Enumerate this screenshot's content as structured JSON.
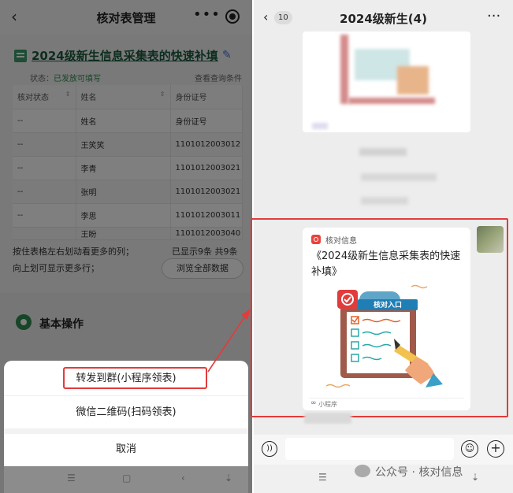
{
  "left_phone": {
    "header": {
      "back_icon": "chevron-left-icon",
      "title": "核对表管理",
      "more_glyph": "•••",
      "target_icon": "target-icon"
    },
    "form_title": "2024级新生信息采集表的快速补填",
    "status_label": "状态：",
    "status_value": "已发放可填写",
    "query_link": "查看查询条件",
    "table": {
      "headers": [
        "核对状态",
        "姓名",
        "身份证号"
      ],
      "rows": [
        [
          "--",
          "姓名",
          "身份证号"
        ],
        [
          "--",
          "王笑笑",
          "1101012003012"
        ],
        [
          "--",
          "李青",
          "1101012003021"
        ],
        [
          "--",
          "张明",
          "1101012003021"
        ],
        [
          "--",
          "李思",
          "1101012003011"
        ],
        [
          "",
          "王盼",
          "1101012003040"
        ]
      ]
    },
    "scroll_hint_1": "按住表格左右划动看更多的列；",
    "scroll_hint_2": "向上划可显示更多行；",
    "shown_count": "已显示9条 共9条",
    "browse_all_button": "浏览全部数据",
    "basic_ops_title": "基本操作",
    "action_sheet": {
      "option_forward_group": "转发到群(小程序领表)",
      "option_qr_code": "微信二维码(扫码领表)",
      "cancel": "取消"
    }
  },
  "right_phone": {
    "header": {
      "unread_count": "10",
      "title": "2024级新生(4)",
      "more_glyph": "···"
    },
    "mini_program_card": {
      "source": "核对信息",
      "title": "《2024级新生信息采集表的快速补填》",
      "illustration_label": "核对入口",
      "type_label": "小程序"
    }
  },
  "watermark": "公众号 · 核对信息",
  "colors": {
    "highlight": "#e23b3b",
    "accent_green": "#2f8a4f",
    "mini_program_red": "#e8423c"
  }
}
